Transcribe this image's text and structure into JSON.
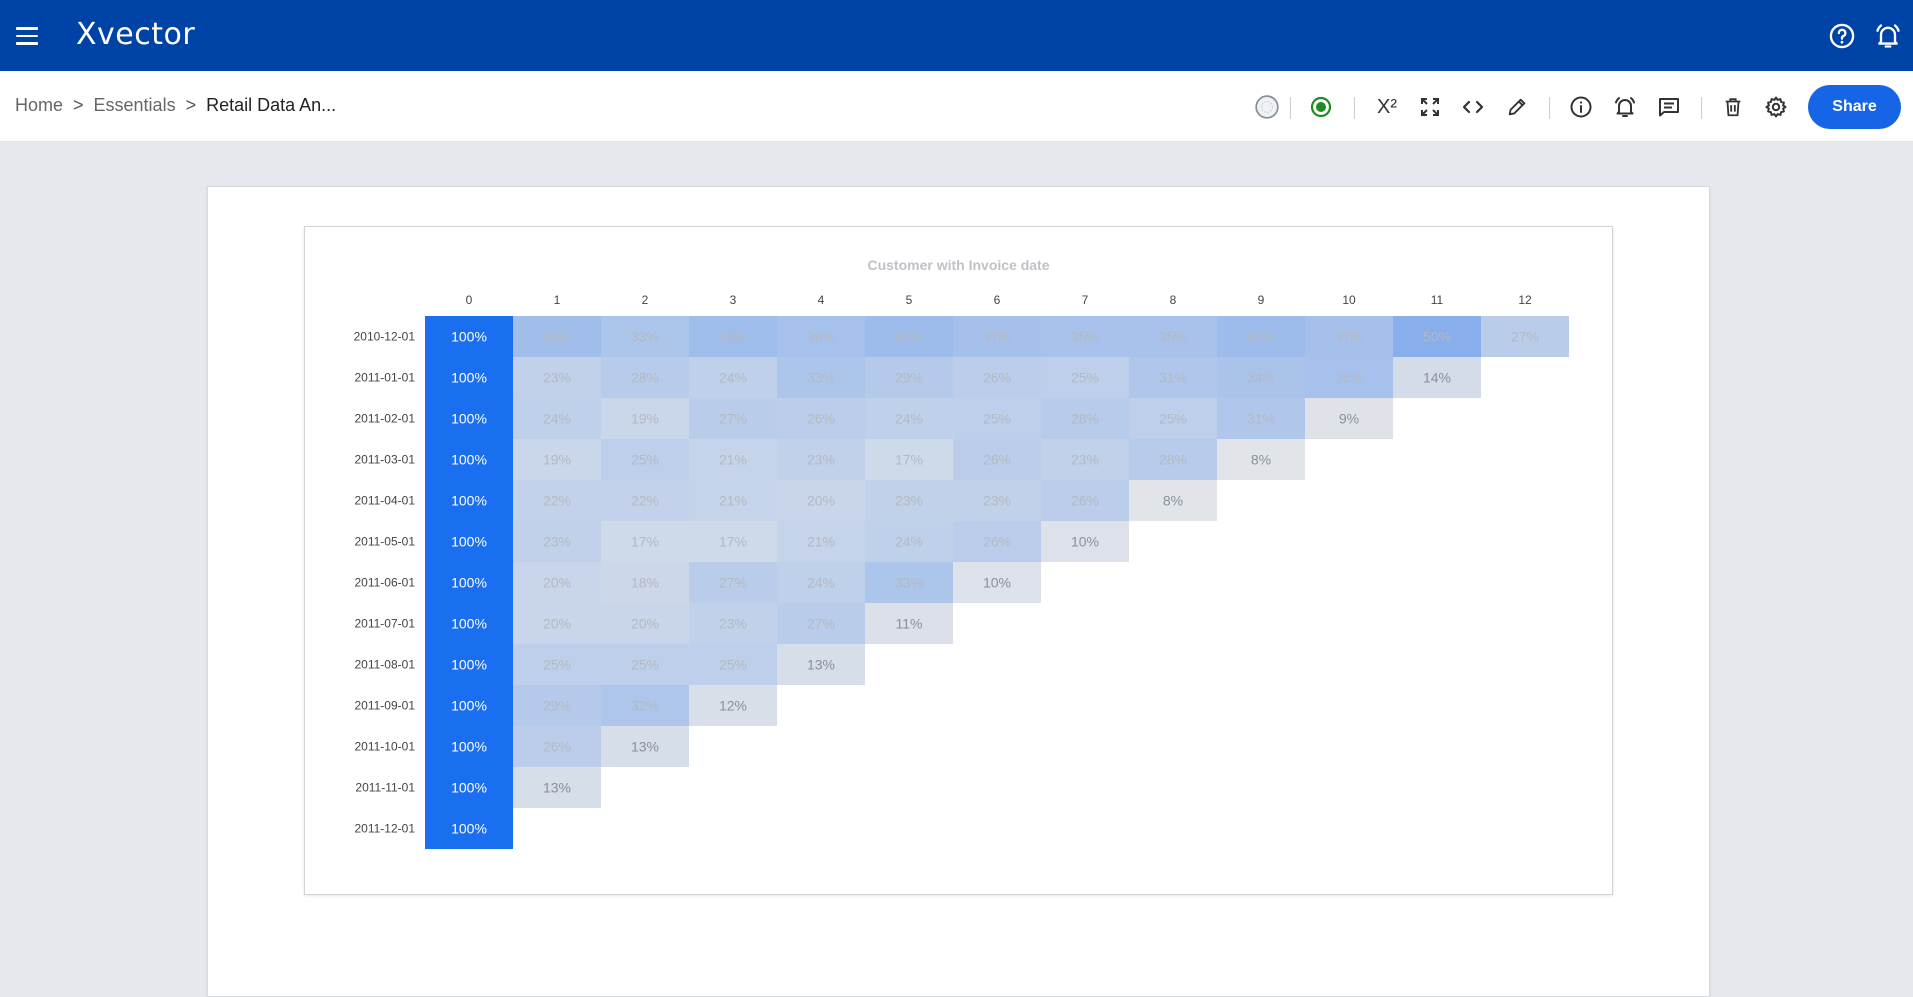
{
  "app": {
    "name": "Xvector"
  },
  "breadcrumb": {
    "home": "Home",
    "separator": ">",
    "section": "Essentials",
    "current": "Retail Data An..."
  },
  "toolbar": {
    "share_label": "Share",
    "superscript_label": "X²"
  },
  "icons": {
    "menu": "menu-icon",
    "help": "help-icon",
    "notifications": "bell-icon",
    "status_placeholder": "status-dot-icon",
    "active": "active-record-icon",
    "formula": "superscript-icon",
    "fullscreen": "fullscreen-icon",
    "code": "code-icon",
    "edit": "pencil-icon",
    "info": "info-icon",
    "alert": "alarm-icon",
    "comment": "comment-icon",
    "delete": "trash-icon",
    "settings": "gear-icon"
  },
  "colors": {
    "header": "#0043a6",
    "share_button": "#1565e6",
    "accent_green": "#1e8c23",
    "cell_full": "#1a6ef0",
    "cell_low": "#e1e4e9"
  },
  "chart_data": {
    "type": "heatmap",
    "title": "Customer with Invoice date",
    "columns": [
      "0",
      "1",
      "2",
      "3",
      "4",
      "5",
      "6",
      "7",
      "8",
      "9",
      "10",
      "11",
      "12"
    ],
    "rows": [
      "2010-12-01",
      "2011-01-01",
      "2011-02-01",
      "2011-03-01",
      "2011-04-01",
      "2011-05-01",
      "2011-06-01",
      "2011-07-01",
      "2011-08-01",
      "2011-09-01",
      "2011-10-01",
      "2011-11-01",
      "2011-12-01"
    ],
    "values": [
      [
        100,
        38,
        33,
        39,
        36,
        40,
        37,
        35,
        35,
        40,
        37,
        50,
        27
      ],
      [
        100,
        23,
        28,
        24,
        33,
        29,
        26,
        25,
        31,
        34,
        36,
        14
      ],
      [
        100,
        24,
        19,
        27,
        26,
        24,
        25,
        28,
        25,
        31,
        9
      ],
      [
        100,
        19,
        25,
        21,
        23,
        17,
        26,
        23,
        28,
        8
      ],
      [
        100,
        22,
        22,
        21,
        20,
        23,
        23,
        26,
        8
      ],
      [
        100,
        23,
        17,
        17,
        21,
        24,
        26,
        10
      ],
      [
        100,
        20,
        18,
        27,
        24,
        33,
        10
      ],
      [
        100,
        20,
        20,
        23,
        27,
        11
      ],
      [
        100,
        25,
        25,
        25,
        13
      ],
      [
        100,
        29,
        32,
        12
      ],
      [
        100,
        26,
        13
      ],
      [
        100,
        13
      ],
      [
        100
      ]
    ],
    "value_suffix": "%",
    "legend": "none"
  }
}
